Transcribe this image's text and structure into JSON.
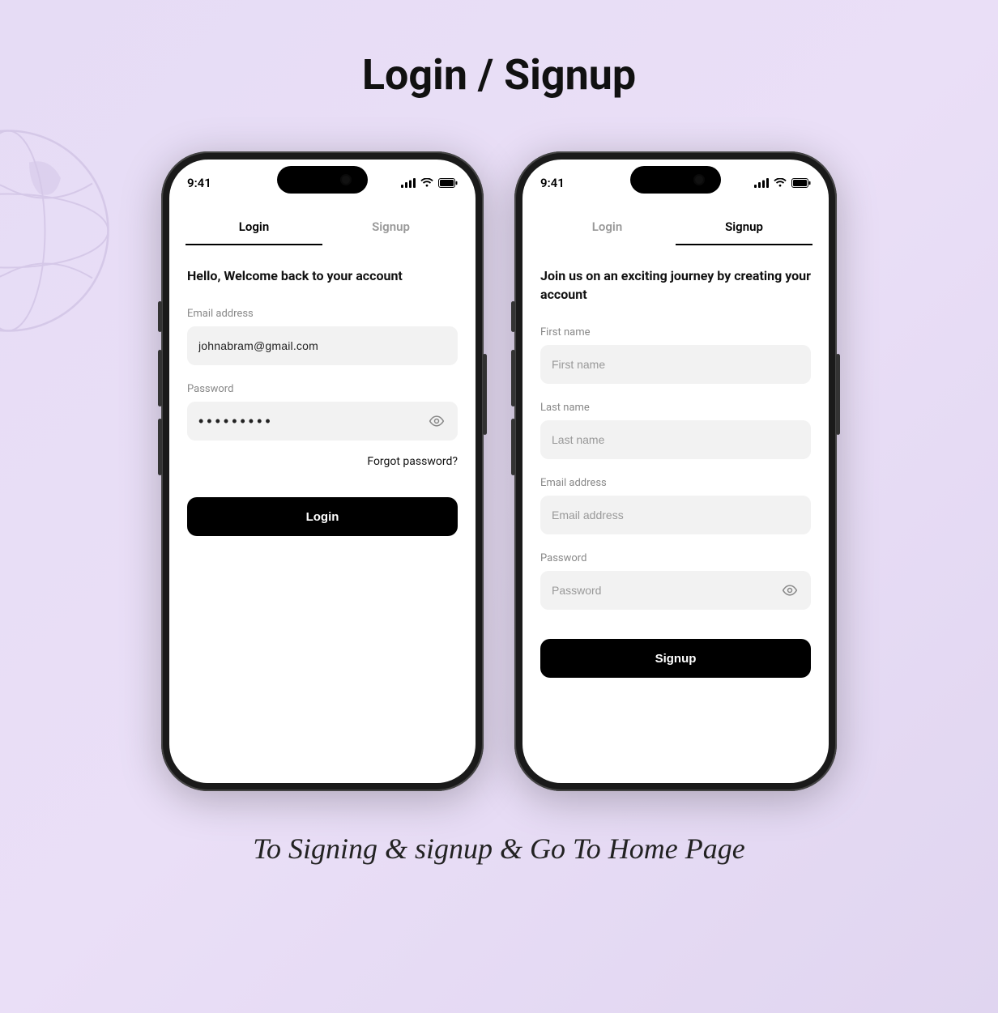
{
  "page": {
    "title": "Login / Signup",
    "caption": "To Signing & signup & Go To Home Page"
  },
  "status_bar": {
    "time": "9:41"
  },
  "tabs": {
    "login": "Login",
    "signup": "Signup"
  },
  "login_screen": {
    "heading": "Hello, Welcome back to your account",
    "email_label": "Email address",
    "email_value": "johnabram@gmail.com",
    "password_label": "Password",
    "password_value": "•••••••••",
    "forgot": "Forgot password?",
    "submit": "Login"
  },
  "signup_screen": {
    "heading": "Join us on an exciting journey by creating your account",
    "first_name_label": "First name",
    "first_name_placeholder": "First name",
    "last_name_label": "Last name",
    "last_name_placeholder": "Last name",
    "email_label": "Email address",
    "email_placeholder": "Email address",
    "password_label": "Password",
    "password_placeholder": "Password",
    "submit": "Signup"
  }
}
